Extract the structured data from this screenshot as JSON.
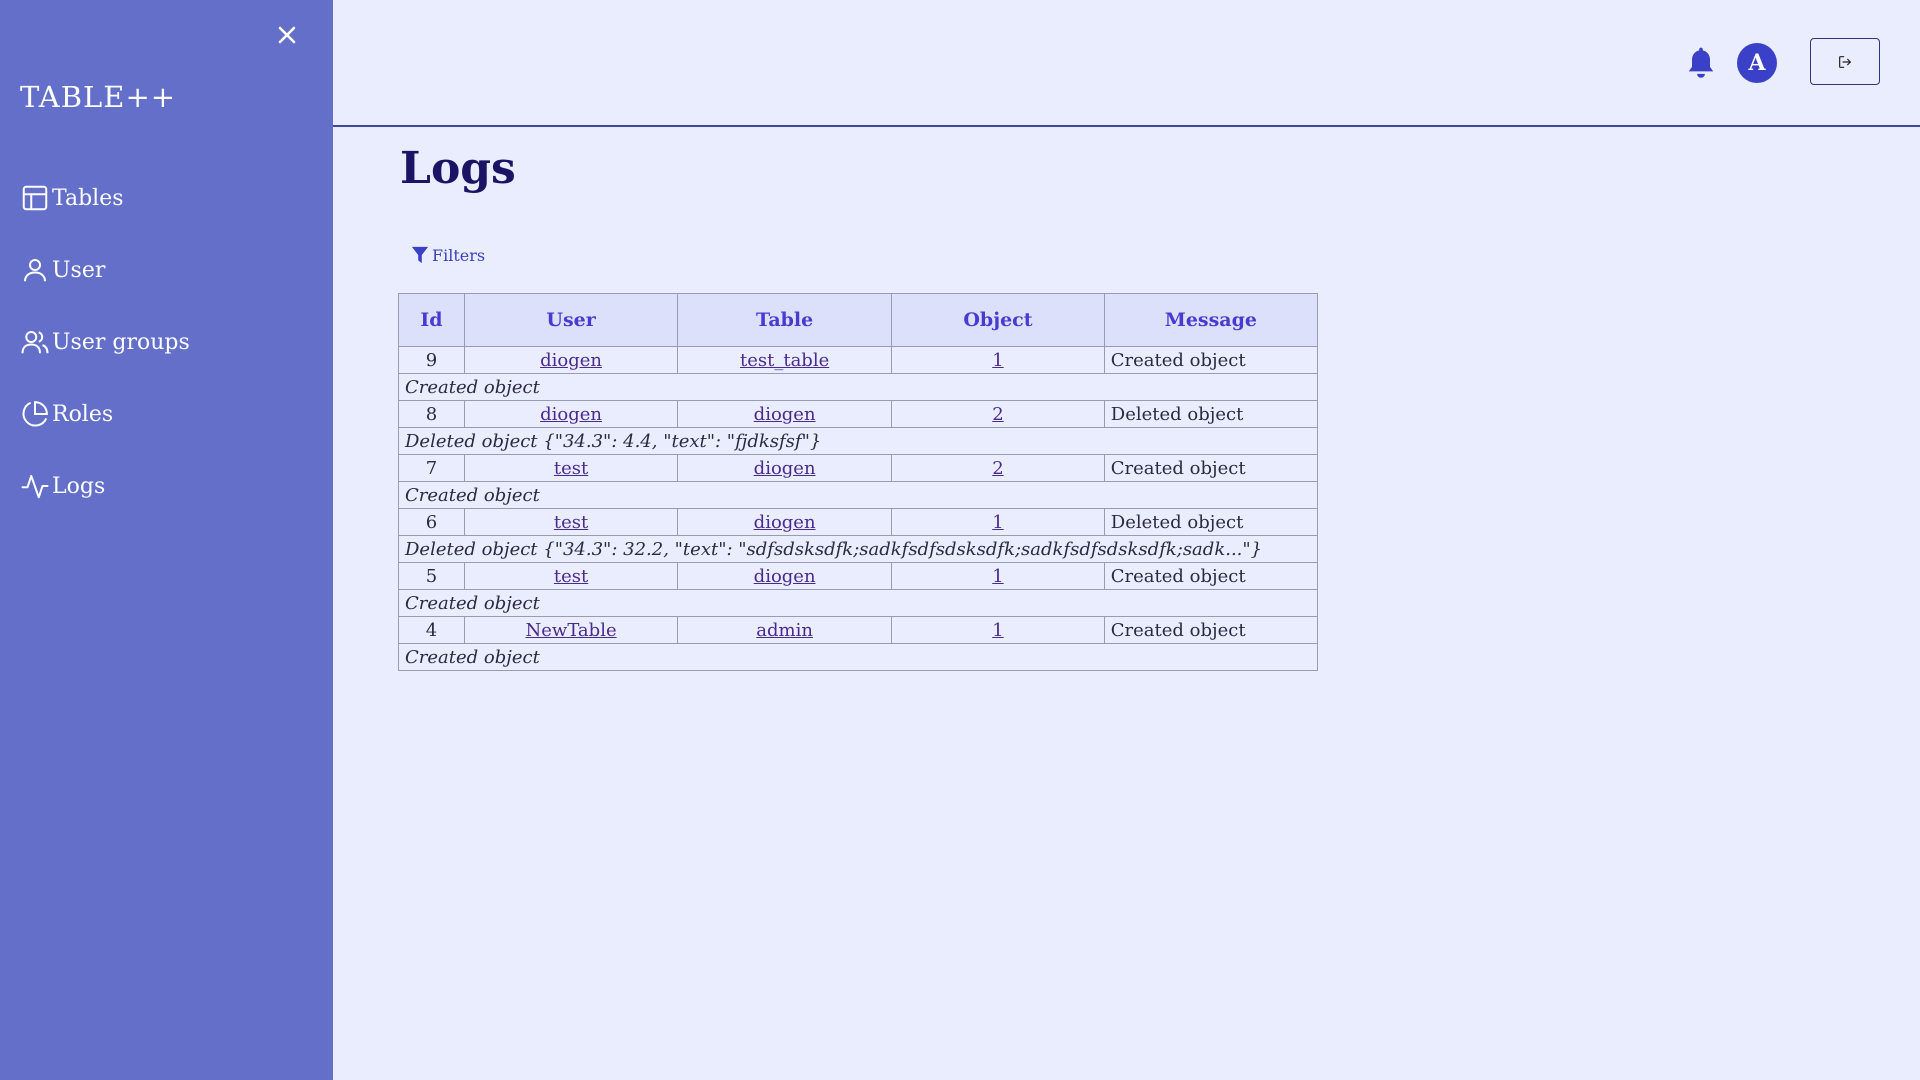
{
  "app": {
    "logo": "TABLE++"
  },
  "sidebar": {
    "items": [
      {
        "label": "Tables",
        "icon": "table-icon"
      },
      {
        "label": "User",
        "icon": "user-icon"
      },
      {
        "label": "User groups",
        "icon": "users-icon"
      },
      {
        "label": "Roles",
        "icon": "pie-chart-icon"
      },
      {
        "label": "Logs",
        "icon": "activity-icon"
      }
    ]
  },
  "header": {
    "avatar_letter": "A"
  },
  "page": {
    "title": "Logs",
    "filters_label": "Filters"
  },
  "table": {
    "columns": [
      "Id",
      "User",
      "Table",
      "Object",
      "Message"
    ],
    "rows": [
      {
        "id": "9",
        "user": "diogen",
        "table": "test_table",
        "object": "1",
        "message": "Created object",
        "detail": "Created object"
      },
      {
        "id": "8",
        "user": "diogen",
        "table": "diogen",
        "object": "2",
        "message": "Deleted object",
        "detail": "Deleted object {\"34.3\": 4.4, \"text\": \"fjdksfsf\"}"
      },
      {
        "id": "7",
        "user": "test",
        "table": "diogen",
        "object": "2",
        "message": "Created object",
        "detail": "Created object"
      },
      {
        "id": "6",
        "user": "test",
        "table": "diogen",
        "object": "1",
        "message": "Deleted object",
        "detail": "Deleted object {\"34.3\": 32.2, \"text\": \"sdfsdsksdfk;sadkfsdfsdsksdfk;sadkfsdfsdsksdfk;sadk...\"}"
      },
      {
        "id": "5",
        "user": "test",
        "table": "diogen",
        "object": "1",
        "message": "Created object",
        "detail": "Created object"
      },
      {
        "id": "4",
        "user": "NewTable",
        "table": "admin",
        "object": "1",
        "message": "Created object",
        "detail": "Created object"
      }
    ]
  },
  "colors": {
    "sidebar_bg": "#636fc8",
    "page_bg": "#eaedfe",
    "accent": "#3a40c7",
    "title": "#1b1464"
  }
}
